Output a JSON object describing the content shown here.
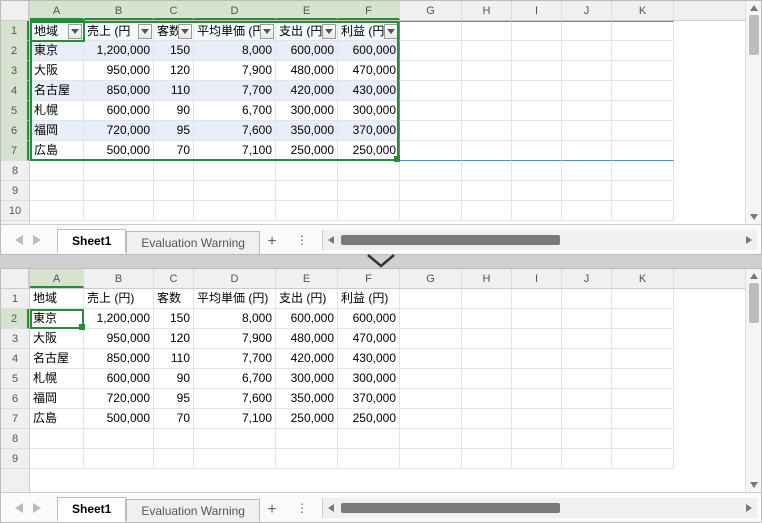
{
  "columns": [
    "A",
    "B",
    "C",
    "D",
    "E",
    "F",
    "G",
    "H",
    "I",
    "J",
    "K"
  ],
  "col_classes": [
    "cA",
    "cB",
    "cC",
    "cD",
    "cE",
    "cF",
    "cG",
    "cH",
    "cI",
    "cJ",
    "cK"
  ],
  "row_numbers": [
    1,
    2,
    3,
    4,
    5,
    6,
    7,
    8,
    9,
    10
  ],
  "row_numbers_bottom": [
    1,
    2,
    3,
    4,
    5,
    6,
    7,
    8,
    9
  ],
  "headers_top": [
    "地域",
    "売上 (円",
    "客数",
    "平均単価 (円",
    "支出 (円",
    "利益 (円"
  ],
  "headers_bottom": [
    "地域",
    "売上 (円)",
    "客数",
    "平均単価 (円)",
    "支出 (円)",
    "利益 (円)"
  ],
  "rows": [
    {
      "region": "東京",
      "sales": "1,200,000",
      "cust": "150",
      "avg": "8,000",
      "exp": "600,000",
      "profit": "600,000"
    },
    {
      "region": "大阪",
      "sales": "950,000",
      "cust": "120",
      "avg": "7,900",
      "exp": "480,000",
      "profit": "470,000"
    },
    {
      "region": "名古屋",
      "sales": "850,000",
      "cust": "110",
      "avg": "7,700",
      "exp": "420,000",
      "profit": "430,000"
    },
    {
      "region": "札幌",
      "sales": "600,000",
      "cust": "90",
      "avg": "6,700",
      "exp": "300,000",
      "profit": "300,000"
    },
    {
      "region": "福岡",
      "sales": "720,000",
      "cust": "95",
      "avg": "7,600",
      "exp": "350,000",
      "profit": "370,000"
    },
    {
      "region": "広島",
      "sales": "500,000",
      "cust": "70",
      "avg": "7,100",
      "exp": "250,000",
      "profit": "250,000"
    }
  ],
  "tabs": {
    "sheet1": "Sheet1",
    "warning": "Evaluation Warning",
    "add": "+"
  },
  "selection_top": {
    "active": "A1",
    "range": "A1:F7"
  },
  "selection_bottom": {
    "active": "A2"
  }
}
